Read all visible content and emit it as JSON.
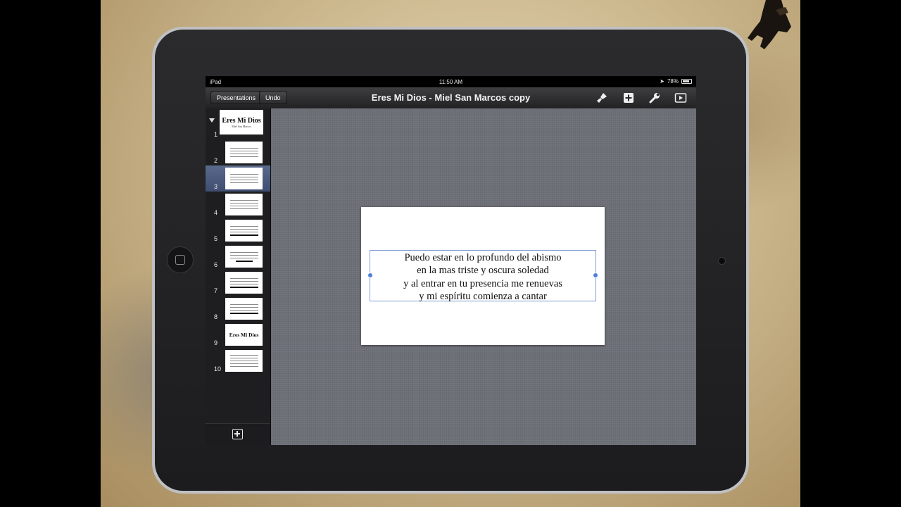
{
  "statusbar": {
    "device": "iPad",
    "time": "11:50 AM",
    "battery": "78%"
  },
  "toolbar": {
    "presentations_label": "Presentations",
    "undo_label": "Undo",
    "document_title": "Eres Mi Dios - Miel San Marcos copy",
    "icons": [
      "paintbrush-icon",
      "insert-plus-icon",
      "wrench-icon",
      "play-icon"
    ]
  },
  "navigator": {
    "selected_slide": 3,
    "slides": [
      {
        "num": "1",
        "title": "Eres Mi Dios",
        "subtitle": "Miel San Marcos"
      },
      {
        "num": "2"
      },
      {
        "num": "3"
      },
      {
        "num": "4"
      },
      {
        "num": "5"
      },
      {
        "num": "6"
      },
      {
        "num": "7"
      },
      {
        "num": "8"
      },
      {
        "num": "9",
        "title": "Eres Mi Dios"
      },
      {
        "num": "10"
      }
    ]
  },
  "slide": {
    "lines": [
      "Puedo estar en lo profundo del abismo",
      "en la mas triste y oscura soledad",
      "y al entrar en tu presencia me renuevas",
      "y mi espíritu comienza a cantar"
    ]
  },
  "colors": {
    "selection": "#4f7fd9",
    "canvas": "#6e7078",
    "selected_row": "#4d5c80"
  }
}
